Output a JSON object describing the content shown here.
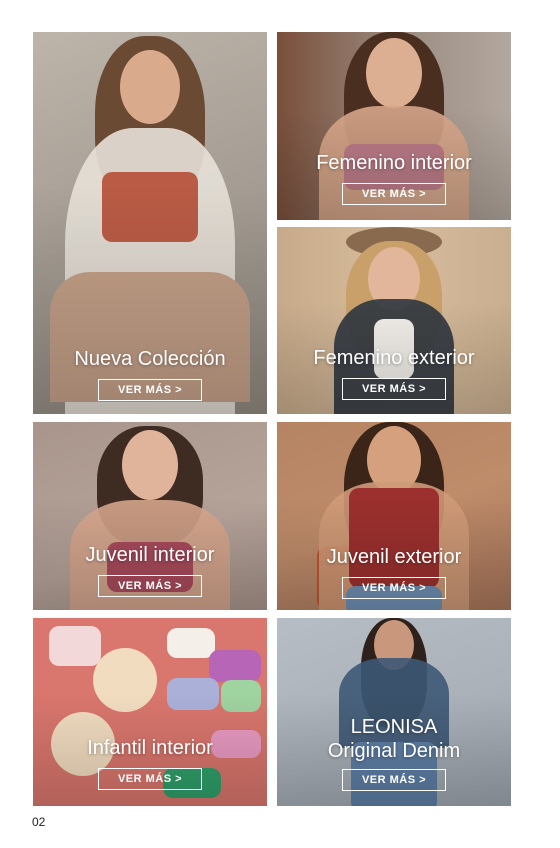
{
  "tiles": [
    {
      "title": "Nueva Colección",
      "cta": "VER MÁS >"
    },
    {
      "title": "Femenino interior",
      "cta": "VER MÁS >"
    },
    {
      "title": "Femenino exterior",
      "cta": "VER MÁS >"
    },
    {
      "title": "Juvenil interior",
      "cta": "VER MÁS >"
    },
    {
      "title": "Juvenil exterior",
      "cta": "VER MÁS >"
    },
    {
      "title": "Infantil interior",
      "cta": "VER MÁS >"
    },
    {
      "title_line1": "LEONISA",
      "title_line2": "Original Denim",
      "cta": "VER MÁS >"
    }
  ],
  "page_number": "02",
  "colors": {
    "cta_border": "#ffffff",
    "title_text": "#ffffff"
  }
}
